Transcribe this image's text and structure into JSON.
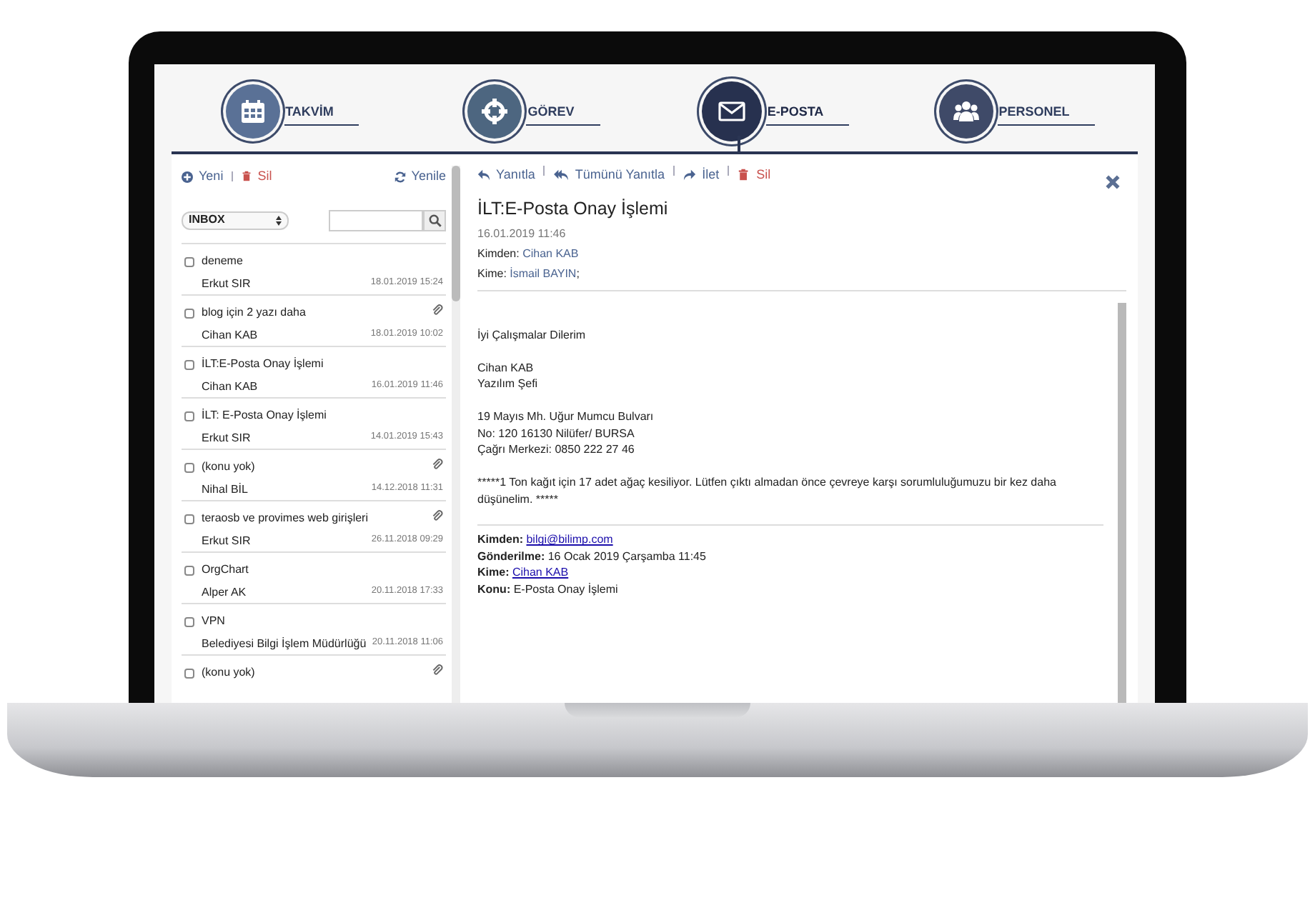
{
  "nav_tabs": [
    {
      "label": "TAKVİM",
      "kind": "calendar",
      "selected": false
    },
    {
      "label": "GÖREV",
      "kind": "task",
      "selected": false
    },
    {
      "label": "E-POSTA",
      "kind": "mail",
      "selected": true
    },
    {
      "label": "PERSONEL",
      "kind": "staff",
      "selected": false
    }
  ],
  "list_toolbar": {
    "new": "Yeni",
    "delete": "Sil",
    "refresh": "Yenile"
  },
  "folder": "INBOX",
  "messages": [
    {
      "subject": "deneme",
      "sender": "Erkut SIR",
      "date": "18.01.2019 15:24",
      "attachment": false,
      "checked": false
    },
    {
      "subject": "blog için 2 yazı daha",
      "sender": "Cihan KAB",
      "date": "18.01.2019 10:02",
      "attachment": true,
      "checked": false
    },
    {
      "subject": "İLT:E-Posta Onay İşlemi",
      "sender": "Cihan KAB",
      "date": "16.01.2019 11:46",
      "attachment": false,
      "checked": false
    },
    {
      "subject": "İLT: E-Posta Onay İşlemi",
      "sender": "Erkut SIR",
      "date": "14.01.2019 15:43",
      "attachment": false,
      "checked": false
    },
    {
      "subject": "(konu yok)",
      "sender": "Nihal BİL",
      "date": "14.12.2018 11:31",
      "attachment": true,
      "checked": false
    },
    {
      "subject": "teraosb ve provimes web girişleri",
      "sender": "Erkut SIR",
      "date": "26.11.2018 09:29",
      "attachment": true,
      "checked": false
    },
    {
      "subject": "OrgChart",
      "sender": "Alper AK",
      "date": "20.11.2018 17:33",
      "attachment": false,
      "checked": false
    },
    {
      "subject": "VPN",
      "sender": "Belediyesi Bilgi İşlem Müdürlüğü",
      "date": "20.11.2018 11:06",
      "attachment": false,
      "checked": false
    },
    {
      "subject": "(konu yok)",
      "attachment": true,
      "checked": false
    }
  ],
  "mail_toolbar": [
    {
      "label": "Yanıtla",
      "kind": "reply"
    },
    {
      "label": "Tümünü Yanıtla",
      "kind": "replyall"
    },
    {
      "label": "İlet",
      "kind": "forward"
    },
    {
      "label": "Sil",
      "kind": "delete"
    }
  ],
  "mail": {
    "subject": "İLT:E-Posta Onay İşlemi",
    "date": "16.01.2019 11:46",
    "meta": [
      {
        "label": "Kimden:",
        "value": "Cihan KAB"
      },
      {
        "label": "Kime:",
        "value": "İsmail BAYIN",
        "suffix": ";"
      }
    ],
    "paragraphs": [
      [
        "İyi Çalışmalar Dilerim"
      ],
      [
        "Cihan KAB",
        "Yazılım Şefi"
      ],
      [
        "19 Mayıs Mh. Uğur Mumcu Bulvarı",
        "No: 120 16130 Nilüfer/ BURSA",
        "Çağrı Merkezi: 0850 222 27 46"
      ],
      [
        "*****1 Ton kağıt için 17 adet ağaç kesiliyor. Lütfen çıktı almadan önce çevreye karşı sorumluluğumuzu bir kez daha düşünelim. *****"
      ]
    ],
    "quoted_header": [
      {
        "label": "Kimden:",
        "value": "bilgi@bilimp.com",
        "link": true
      },
      {
        "label": "Gönderilme:",
        "value": "16 Ocak 2019 Çarşamba 11:45",
        "link": false
      },
      {
        "label": "Kime:",
        "value": "Cihan KAB",
        "link": true
      },
      {
        "label": "Konu:",
        "value": "E-Posta Onay İşlemi",
        "link": false
      }
    ]
  }
}
